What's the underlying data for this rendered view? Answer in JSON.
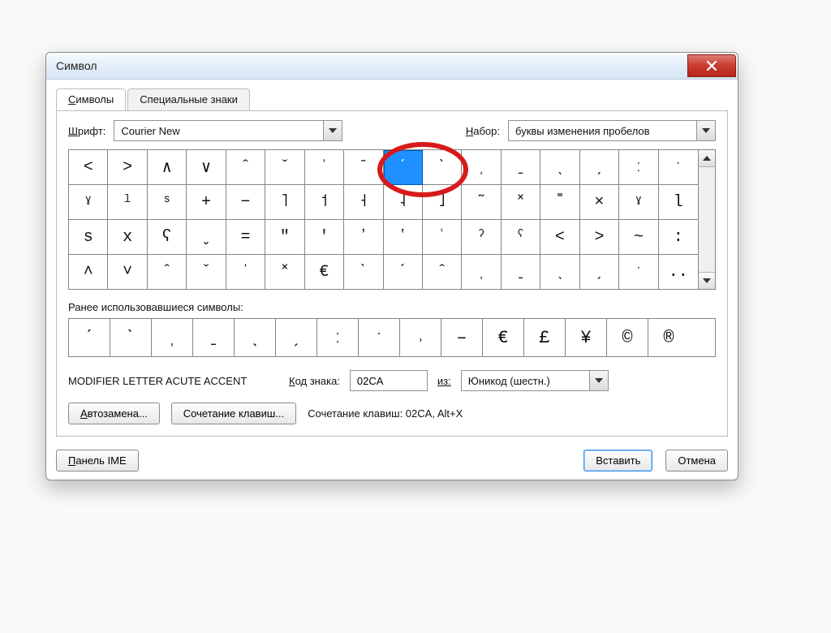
{
  "title": "Символ",
  "tabs": {
    "symbols": "Символы",
    "special": "Специальные знаки"
  },
  "font_label": "Шрифт:",
  "font_value": "Courier New",
  "set_label": "Набор:",
  "set_value": "буквы изменения пробелов",
  "grid": [
    "<",
    ">",
    "∧",
    "∨",
    "ˆ",
    "ˇ",
    "ˈ",
    "ˉ",
    "ˊ",
    "ˋ",
    "ˌ",
    "ˍ",
    "ˎ",
    "ˏ",
    "ː",
    "ˑ",
    "ˠ",
    "ˡ",
    "ˢ",
    "+",
    "−",
    "˥",
    "˦",
    "˧",
    "˨",
    "˩",
    "˜",
    "˟",
    "˭",
    "×",
    "ˠ",
    "l",
    "s",
    "x",
    "ʕ",
    "ˬ",
    "=",
    "ʺ",
    "ʹ",
    "ʼ",
    "ʽ",
    "ʿ",
    "ˀ",
    "ˁ",
    "˂",
    "˃",
    "~",
    ":",
    "˄",
    "˅",
    "ˆ",
    "ˇ",
    "ˈ",
    "˟",
    "€",
    "ˋ",
    "ˊ",
    "ˆ",
    "ˌ",
    "ˍ",
    "ˎ",
    "ˏ",
    "ˑ",
    ".."
  ],
  "selected_index": 8,
  "recent_label": "Ранее использовавшиеся символы:",
  "recent": [
    "ˊ",
    "ˋ",
    "ˌ",
    "ˍ",
    "ˎ",
    "ˏ",
    "ː",
    "ˑ",
    "˒",
    "–",
    "€",
    "£",
    "¥",
    "©",
    "®"
  ],
  "symbol_name": "MODIFIER LETTER ACUTE ACCENT",
  "code_label": "Код знака:",
  "code_value": "02CA",
  "from_label": "из:",
  "from_value": "Юникод (шестн.)",
  "autocorrect_btn": "Автозамена...",
  "shortcut_btn": "Сочетание клавиш...",
  "shortcut_text": "Сочетание клавиш: 02CA, Alt+X",
  "ime_btn": "Панель IME",
  "insert_btn": "Вставить",
  "cancel_btn": "Отмена"
}
